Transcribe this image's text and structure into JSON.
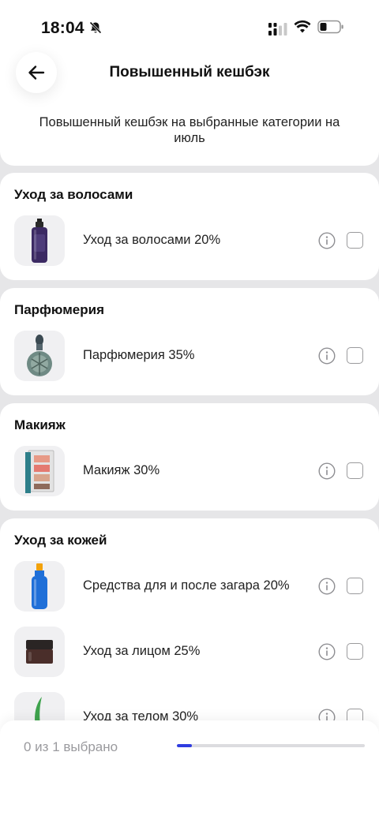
{
  "status_bar": {
    "time": "18:04"
  },
  "header": {
    "title": "Повышенный кешбэк",
    "subtitle": "Повышенный кешбэк на выбранные категории на июль"
  },
  "sections": [
    {
      "title": "Уход за волосами",
      "items": [
        {
          "label": "Уход за волосами 20%",
          "icon": "shampoo-bottle"
        }
      ]
    },
    {
      "title": "Парфюмерия",
      "items": [
        {
          "label": "Парфюмерия 35%",
          "icon": "perfume-bottle"
        }
      ]
    },
    {
      "title": "Макияж",
      "items": [
        {
          "label": "Макияж 30%",
          "icon": "eyeshadow-palette"
        }
      ]
    },
    {
      "title": "Уход за кожей",
      "items": [
        {
          "label": "Средства для и после загара 20%",
          "icon": "sunscreen-bottle"
        },
        {
          "label": "Уход за лицом 25%",
          "icon": "cream-jar"
        },
        {
          "label": "Уход за телом 30%",
          "icon": "aloe-leaf"
        }
      ]
    }
  ],
  "footer": {
    "selected_text": "0 из 1 выбрано",
    "progress": 0.08,
    "accent_color": "#2f3ce0"
  }
}
